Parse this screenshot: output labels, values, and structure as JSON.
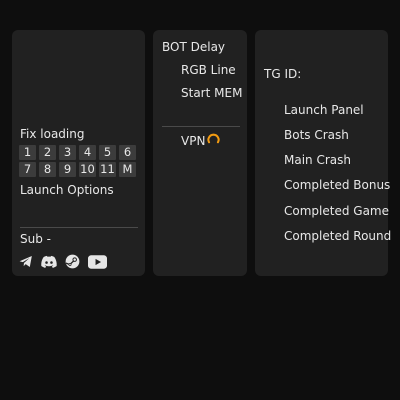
{
  "left_panel": {
    "fix_loading": "Fix loading",
    "number_rows": [
      [
        "1",
        "2",
        "3",
        "4",
        "5",
        "6"
      ],
      [
        "7",
        "8",
        "9",
        "10",
        "11",
        "M"
      ]
    ],
    "launch_options": "Launch Options",
    "sub_label": "Sub -",
    "social_icons": [
      "telegram-icon",
      "discord-icon",
      "steam-icon",
      "youtube-icon"
    ]
  },
  "middle_panel": {
    "bot_delay": "BOT Delay",
    "rgb_line": "RGB Line",
    "start_mem": "Start MEM",
    "vpn": "VPN",
    "vpn_icon": "loading-spinner-icon",
    "vpn_icon_color": "#f39c12"
  },
  "right_panel": {
    "tg_id": "TG ID:",
    "items": [
      "Launch Panel",
      "Bots Crash",
      "Main Crash",
      "Completed Bonus",
      "Completed Game",
      "Completed Round"
    ]
  }
}
